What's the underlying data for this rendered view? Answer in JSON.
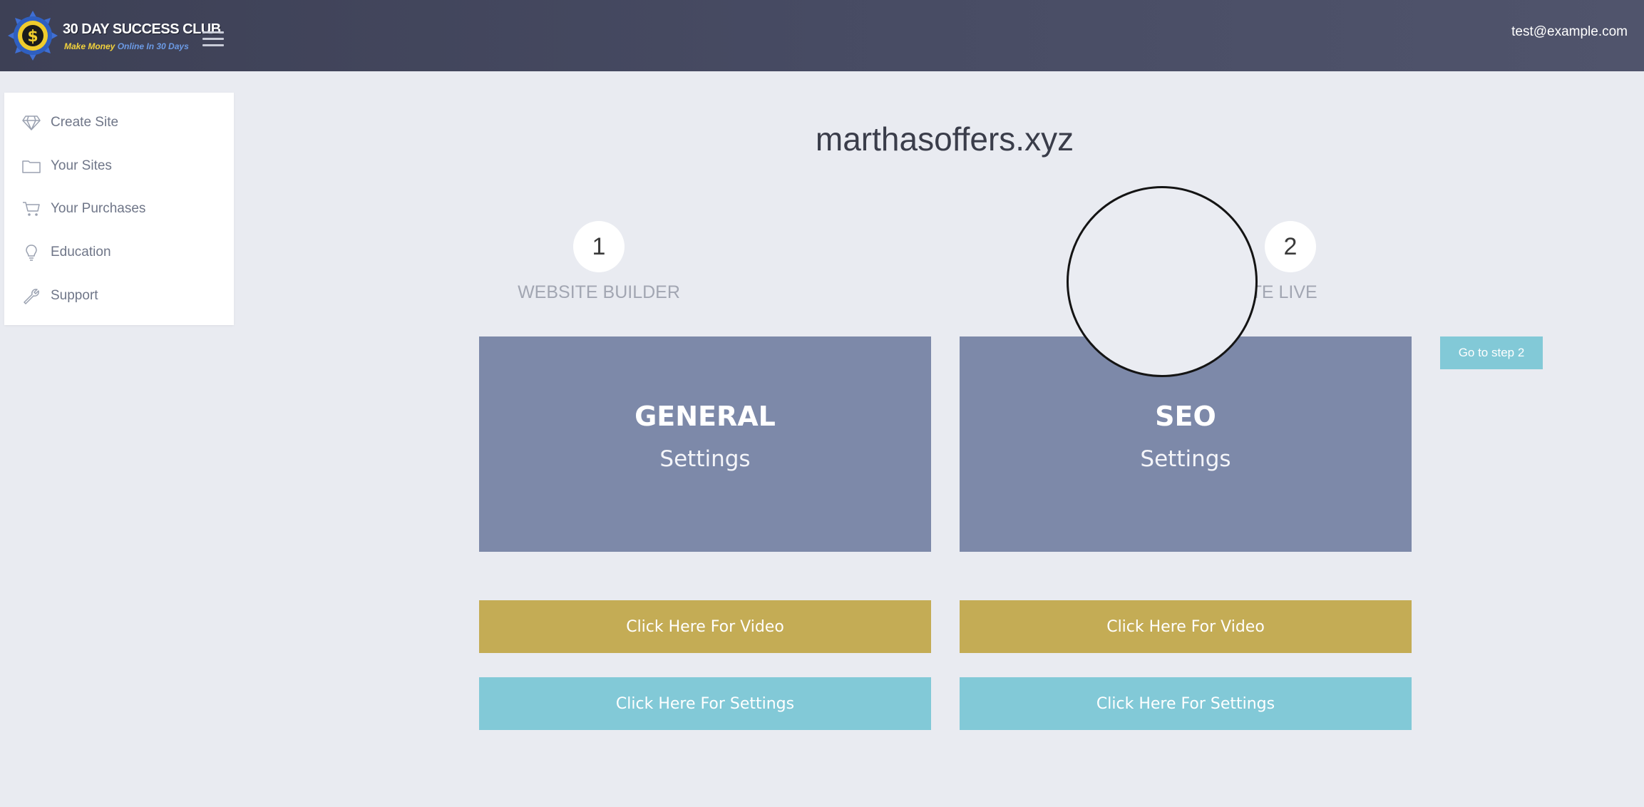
{
  "header": {
    "brand_title": "30 DAY SUCCESS CLUB",
    "brand_sub_1": "Make Money",
    "brand_sub_2": "Online In 30 Days",
    "menu_icon": "hamburger-icon",
    "user_email": "test@example.com"
  },
  "sidebar": {
    "items": [
      {
        "label": "Create Site",
        "icon": "diamond-icon"
      },
      {
        "label": "Your Sites",
        "icon": "folder-icon"
      },
      {
        "label": "Your Purchases",
        "icon": "cart-icon"
      },
      {
        "label": "Education",
        "icon": "lightbulb-icon"
      },
      {
        "label": "Support",
        "icon": "wrench-icon"
      }
    ]
  },
  "main": {
    "site_name": "marthasoffers.xyz",
    "steps": [
      {
        "number": "1",
        "label": "WEBSITE BUILDER"
      },
      {
        "number": "2",
        "label": "BSITE LIVE"
      }
    ],
    "go_step_label": "Go to step 2",
    "cards": [
      {
        "title": "GENERAL",
        "subtitle": "Settings",
        "video_label": "Click Here For Video",
        "settings_label": "Click Here For Settings"
      },
      {
        "title": "SEO",
        "subtitle": "Settings",
        "video_label": "Click Here For Video",
        "settings_label": "Click Here For Settings"
      }
    ]
  },
  "colors": {
    "topbar": "#464a62",
    "card": "#7d89a9",
    "video_button": "#c4ac55",
    "settings_button": "#82c9d7",
    "page_background": "#e9ebf1"
  }
}
